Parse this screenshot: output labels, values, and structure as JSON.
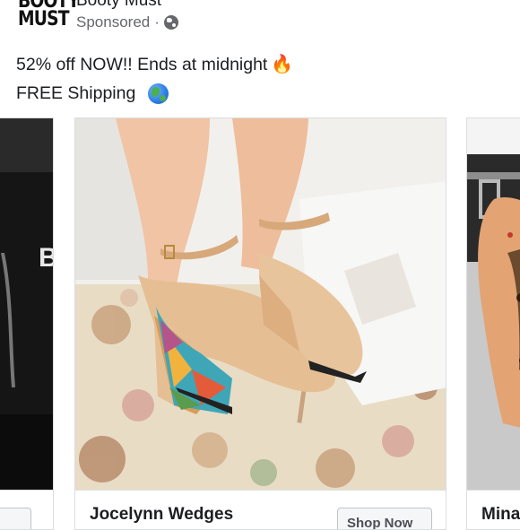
{
  "post": {
    "logo_line1": "BOOTY",
    "logo_line2": "MUST",
    "page_name": "Booty Must",
    "sponsored_label": "Sponsored",
    "separator": "·",
    "privacy_icon": "globe-icon",
    "text_line1": "52% off NOW!!  Ends at midnight",
    "text_line1_emoji": "🔥",
    "text_line2": "FREE Shipping",
    "text_line2_icon": "earth-globe-icon"
  },
  "carousel": {
    "cards": [
      {
        "title": "",
        "cta_label": ""
      },
      {
        "title": "Jocelynn Wedges",
        "cta_label": "Shop Now"
      },
      {
        "title": "Mina",
        "cta_label": ""
      }
    ],
    "left_card_text": "B"
  },
  "colors": {
    "text": "#1c1e21",
    "secondary": "#65676b",
    "border": "#dadde1",
    "shoe": "#e5bf93"
  }
}
